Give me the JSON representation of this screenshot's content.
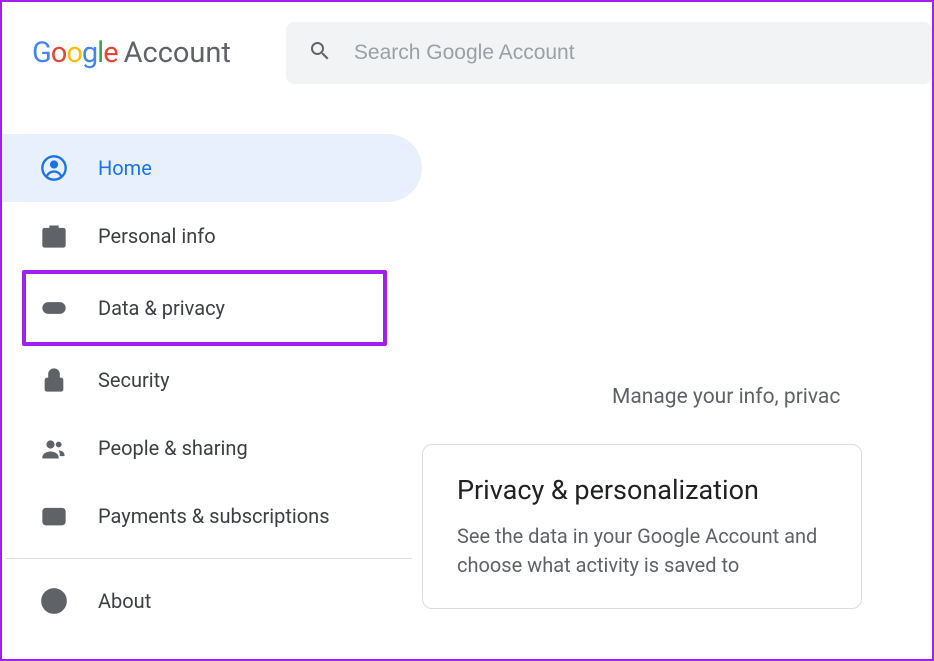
{
  "logo": {
    "brand": "Google",
    "product": "Account"
  },
  "search": {
    "placeholder": "Search Google Account"
  },
  "sidebar": {
    "items": [
      {
        "label": "Home"
      },
      {
        "label": "Personal info"
      },
      {
        "label": "Data & privacy"
      },
      {
        "label": "Security"
      },
      {
        "label": "People & sharing"
      },
      {
        "label": "Payments & subscriptions"
      },
      {
        "label": "About"
      }
    ]
  },
  "main": {
    "tagline": "Manage your info, privac",
    "card": {
      "title": "Privacy & personalization",
      "desc": "See the data in your Google Account and choose what activity is saved to"
    }
  }
}
